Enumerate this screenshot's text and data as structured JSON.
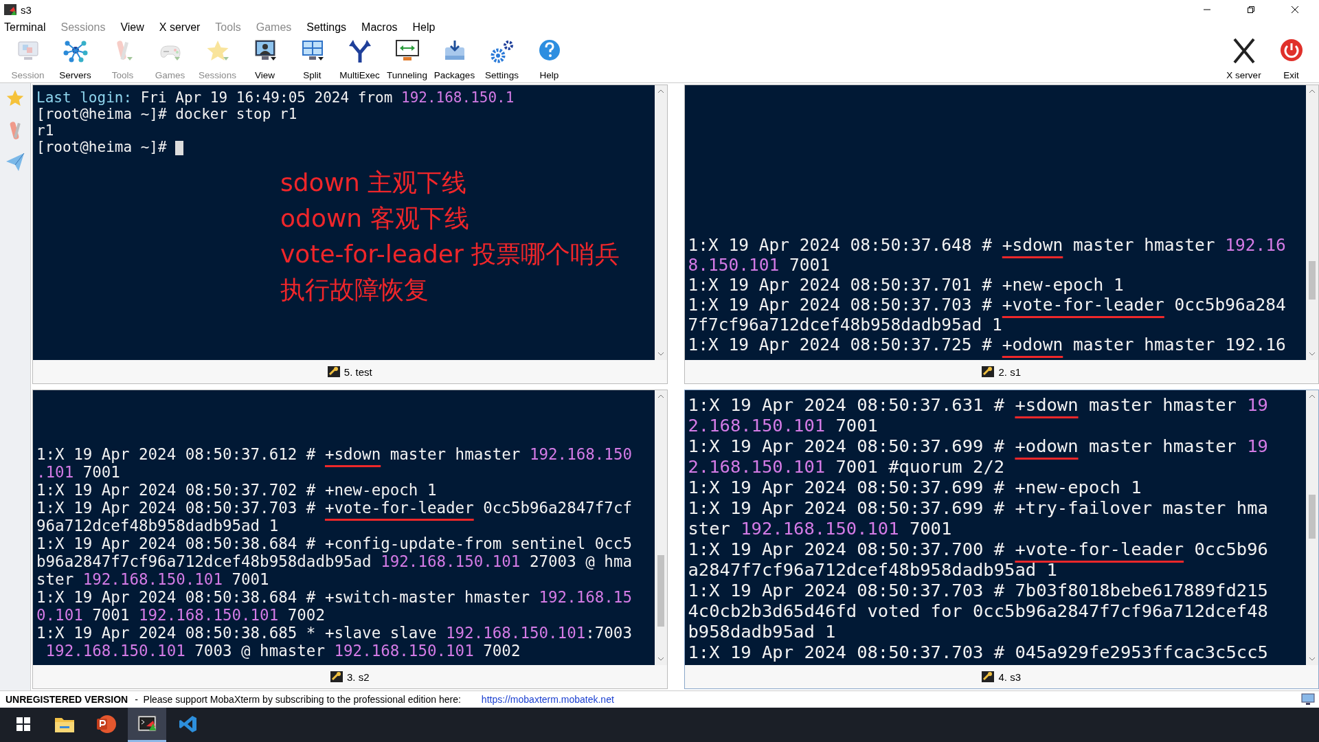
{
  "window": {
    "title": "s3"
  },
  "menu": [
    {
      "label": "Terminal",
      "disabled": false
    },
    {
      "label": "Sessions",
      "disabled": true
    },
    {
      "label": "View",
      "disabled": false
    },
    {
      "label": "X server",
      "disabled": false
    },
    {
      "label": "Tools",
      "disabled": true
    },
    {
      "label": "Games",
      "disabled": true
    },
    {
      "label": "Settings",
      "disabled": false
    },
    {
      "label": "Macros",
      "disabled": false
    },
    {
      "label": "Help",
      "disabled": false
    }
  ],
  "toolbar": [
    {
      "label": "Session",
      "disabled": true
    },
    {
      "label": "Servers",
      "disabled": false
    },
    {
      "label": "Tools",
      "disabled": true
    },
    {
      "label": "Games",
      "disabled": true
    },
    {
      "label": "Sessions",
      "disabled": true
    },
    {
      "label": "View",
      "disabled": false
    },
    {
      "label": "Split",
      "disabled": false
    },
    {
      "label": "MultiExec",
      "disabled": false
    },
    {
      "label": "Tunneling",
      "disabled": false
    },
    {
      "label": "Packages",
      "disabled": false
    },
    {
      "label": "Settings",
      "disabled": false
    },
    {
      "label": "Help",
      "disabled": false
    }
  ],
  "toolbar_right": [
    {
      "label": "X server"
    },
    {
      "label": "Exit"
    }
  ],
  "annotation": [
    "sdown 主观下线",
    "odown 客观下线",
    "vote-for-leader 投票哪个哨兵",
    "执行故障恢复"
  ],
  "panes": [
    {
      "caption": "5. test",
      "cursor": true,
      "lines": [
        [
          {
            "text": "Last login:",
            "kind": "info"
          },
          {
            "text": " Fri Apr 19 16:49:05 2024 from ",
            "kind": "plain"
          },
          {
            "text": "192.168.150.1",
            "kind": "ip"
          }
        ],
        [
          {
            "text": "[root@heima ~]# docker stop r1",
            "kind": "plain"
          }
        ],
        [
          {
            "text": "r1",
            "kind": "plain"
          }
        ],
        [
          {
            "text": "[root@heima ~]# ",
            "kind": "plain"
          }
        ]
      ]
    },
    {
      "caption": "2. s1",
      "cursor": false,
      "lines": [
        [
          {
            "text": "1:X 19 Apr 2024 08:50:37.648 # ",
            "kind": "plain"
          },
          {
            "text": "+sdown",
            "kind": "marked"
          },
          {
            "text": " master hmaster ",
            "kind": "plain"
          },
          {
            "text": "192.16",
            "kind": "ip"
          }
        ],
        [
          {
            "text": "8.150.101",
            "kind": "ip"
          },
          {
            "text": " 7001",
            "kind": "plain"
          }
        ],
        [
          {
            "text": "1:X 19 Apr 2024 08:50:37.701 # +new-epoch 1",
            "kind": "plain"
          }
        ],
        [
          {
            "text": "1:X 19 Apr 2024 08:50:37.703 # ",
            "kind": "plain"
          },
          {
            "text": "+vote-for-leader",
            "kind": "marked"
          },
          {
            "text": " 0cc5b96a284",
            "kind": "plain"
          }
        ],
        [
          {
            "text": "7f7cf96a712dcef48b958dadb95ad 1",
            "kind": "plain"
          }
        ],
        [
          {
            "text": "1:X 19 Apr 2024 08:50:37.725 # ",
            "kind": "plain"
          },
          {
            "text": "+odown",
            "kind": "marked"
          },
          {
            "text": " master hmaster 192.16",
            "kind": "plain"
          }
        ]
      ]
    },
    {
      "caption": "3. s2",
      "cursor": false,
      "lines": [
        [
          {
            "text": "1:X 19 Apr 2024 08:50:37.612 # ",
            "kind": "plain"
          },
          {
            "text": "+sdown",
            "kind": "marked"
          },
          {
            "text": " master hmaster ",
            "kind": "plain"
          },
          {
            "text": "192.168.150",
            "kind": "ip"
          }
        ],
        [
          {
            "text": ".101",
            "kind": "ip"
          },
          {
            "text": " 7001",
            "kind": "plain"
          }
        ],
        [
          {
            "text": "1:X 19 Apr 2024 08:50:37.702 # +new-epoch 1",
            "kind": "plain"
          }
        ],
        [
          {
            "text": "1:X 19 Apr 2024 08:50:37.703 # ",
            "kind": "plain"
          },
          {
            "text": "+vote-for-leader",
            "kind": "marked"
          },
          {
            "text": " 0cc5b96a2847f7cf",
            "kind": "plain"
          }
        ],
        [
          {
            "text": "96a712dcef48b958dadb95ad 1",
            "kind": "plain"
          }
        ],
        [
          {
            "text": "1:X 19 Apr 2024 08:50:38.684 # +config-update-from sentinel 0cc5",
            "kind": "plain"
          }
        ],
        [
          {
            "text": "b96a2847f7cf96a712dcef48b958dadb95ad ",
            "kind": "plain"
          },
          {
            "text": "192.168.150.101",
            "kind": "ip"
          },
          {
            "text": " 27003 @ hma",
            "kind": "plain"
          }
        ],
        [
          {
            "text": "ster ",
            "kind": "plain"
          },
          {
            "text": "192.168.150.101",
            "kind": "ip"
          },
          {
            "text": " 7001",
            "kind": "plain"
          }
        ],
        [
          {
            "text": "1:X 19 Apr 2024 08:50:38.684 # +switch-master hmaster ",
            "kind": "plain"
          },
          {
            "text": "192.168.15",
            "kind": "ip"
          }
        ],
        [
          {
            "text": "0.101",
            "kind": "ip"
          },
          {
            "text": " 7001 ",
            "kind": "plain"
          },
          {
            "text": "192.168.150.101",
            "kind": "ip"
          },
          {
            "text": " 7002",
            "kind": "plain"
          }
        ],
        [
          {
            "text": "1:X 19 Apr 2024 08:50:38.685 * +slave slave ",
            "kind": "plain"
          },
          {
            "text": "192.168.150.101",
            "kind": "ip"
          },
          {
            "text": ":7003",
            "kind": "plain"
          }
        ],
        [
          {
            "text": " 192.168.150.101",
            "kind": "ip"
          },
          {
            "text": " 7003 @ hmaster ",
            "kind": "plain"
          },
          {
            "text": "192.168.150.101",
            "kind": "ip"
          },
          {
            "text": " 7002",
            "kind": "plain"
          }
        ]
      ]
    },
    {
      "caption": "4. s3",
      "cursor": false,
      "lines": [
        [
          {
            "text": "1:X 19 Apr 2024 08:50:37.631 # ",
            "kind": "plain"
          },
          {
            "text": "+sdown",
            "kind": "marked"
          },
          {
            "text": " master hmaster ",
            "kind": "plain"
          },
          {
            "text": "19",
            "kind": "ip"
          }
        ],
        [
          {
            "text": "2.168.150.101",
            "kind": "ip"
          },
          {
            "text": " 7001",
            "kind": "plain"
          }
        ],
        [
          {
            "text": "1:X 19 Apr 2024 08:50:37.699 # ",
            "kind": "plain"
          },
          {
            "text": "+odown",
            "kind": "marked"
          },
          {
            "text": " master hmaster ",
            "kind": "plain"
          },
          {
            "text": "19",
            "kind": "ip"
          }
        ],
        [
          {
            "text": "2.168.150.101",
            "kind": "ip"
          },
          {
            "text": " 7001 #quorum 2/2",
            "kind": "plain"
          }
        ],
        [
          {
            "text": "1:X 19 Apr 2024 08:50:37.699 # +new-epoch 1",
            "kind": "plain"
          }
        ],
        [
          {
            "text": "1:X 19 Apr 2024 08:50:37.699 # +try-failover master hma",
            "kind": "plain"
          }
        ],
        [
          {
            "text": "ster ",
            "kind": "plain"
          },
          {
            "text": "192.168.150.101",
            "kind": "ip"
          },
          {
            "text": " 7001",
            "kind": "plain"
          }
        ],
        [
          {
            "text": "1:X 19 Apr 2024 08:50:37.700 # ",
            "kind": "plain"
          },
          {
            "text": "+vote-for-leader",
            "kind": "marked"
          },
          {
            "text": " 0cc5b96",
            "kind": "plain"
          }
        ],
        [
          {
            "text": "a2847f7cf96a712dcef48b958dadb95ad 1",
            "kind": "plain"
          }
        ],
        [
          {
            "text": "1:X 19 Apr 2024 08:50:37.703 # 7b03f8018bebe617889fd215",
            "kind": "plain"
          }
        ],
        [
          {
            "text": "4c0cb2b3d65d46fd voted for 0cc5b96a2847f7cf96a712dcef48",
            "kind": "plain"
          }
        ],
        [
          {
            "text": "b958dadb95ad 1",
            "kind": "plain"
          }
        ],
        [
          {
            "text": "1:X 19 Apr 2024 08:50:37.703 # 045a929fe2953ffcac3c5cc5",
            "kind": "plain"
          }
        ]
      ]
    }
  ],
  "status_bar": {
    "title": "UNREGISTERED VERSION",
    "message": "-  Please support MobaXterm by subscribing to the professional edition here:",
    "link": "https://mobaxterm.mobatek.net"
  },
  "taskbar": {
    "apps": [
      {
        "selected": false
      },
      {
        "selected": false
      },
      {
        "selected": false
      },
      {
        "selected": true
      },
      {
        "selected": false
      }
    ]
  }
}
